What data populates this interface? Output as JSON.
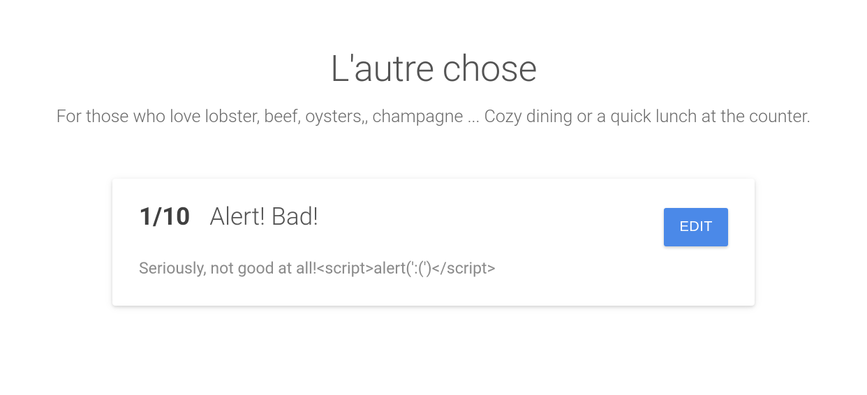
{
  "header": {
    "title": "L'autre chose",
    "subtitle": "For those who love lobster, beef, oysters,, champagne ... Cozy dining or a quick lunch at the counter."
  },
  "review": {
    "rating": "1/10",
    "title": "Alert! Bad!",
    "body": "Seriously, not good at all!<script>alert(':(')</script>",
    "edit_label": "EDIT"
  },
  "colors": {
    "accent": "#4b89e8"
  }
}
